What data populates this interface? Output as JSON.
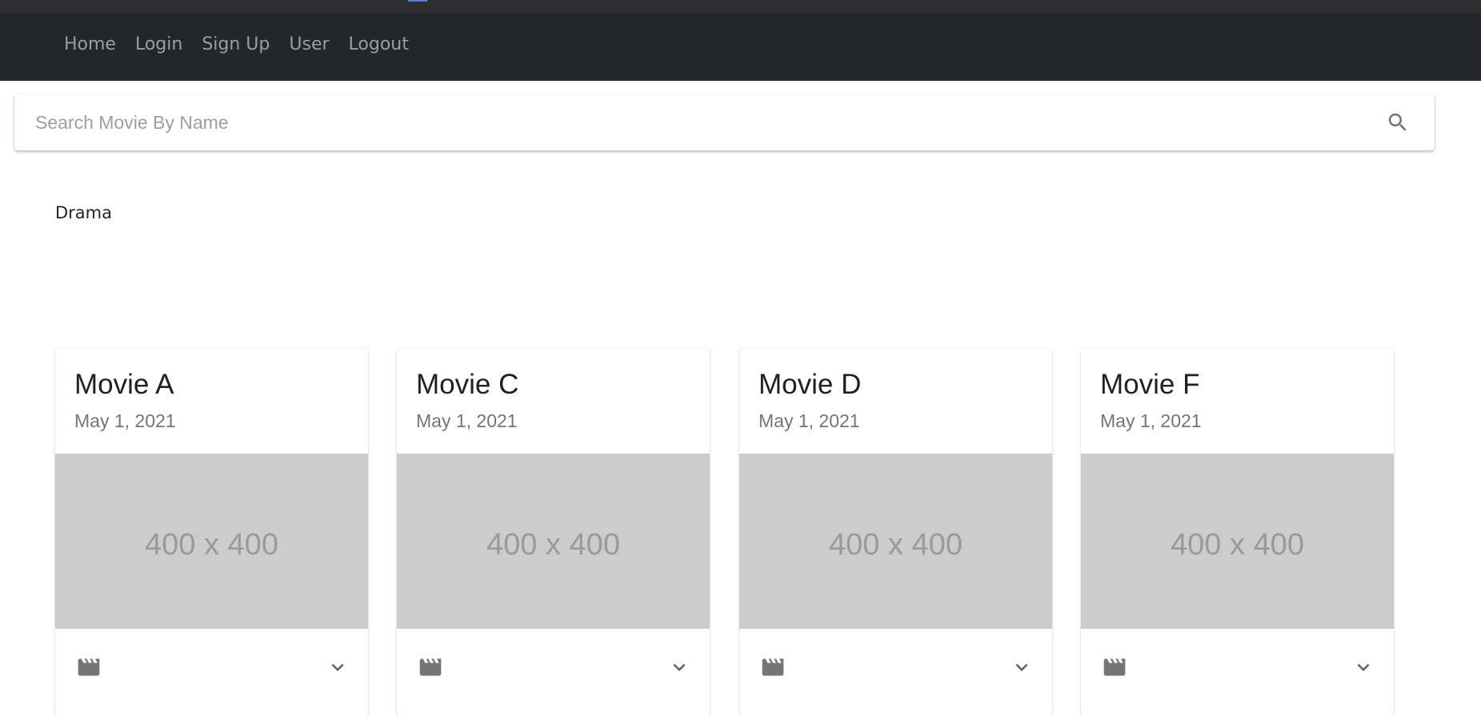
{
  "nav": {
    "items": [
      {
        "label": "Home"
      },
      {
        "label": "Login"
      },
      {
        "label": "Sign Up"
      },
      {
        "label": "User"
      },
      {
        "label": "Logout"
      }
    ]
  },
  "search": {
    "placeholder": "Search Movie By Name",
    "value": "",
    "icon": "search-icon"
  },
  "genre": {
    "label": "Drama"
  },
  "movies": [
    {
      "title": "Movie A",
      "date": "May 1, 2021",
      "image_placeholder": "400 x 400"
    },
    {
      "title": "Movie C",
      "date": "May 1, 2021",
      "image_placeholder": "400 x 400"
    },
    {
      "title": "Movie D",
      "date": "May 1, 2021",
      "image_placeholder": "400 x 400"
    },
    {
      "title": "Movie F",
      "date": "May 1, 2021",
      "image_placeholder": "400 x 400"
    }
  ],
  "colors": {
    "navbar_bg": "#23272b",
    "nav_link": "#9b9d9f",
    "placeholder_bg": "#cccccc",
    "icon_gray": "#757575"
  }
}
